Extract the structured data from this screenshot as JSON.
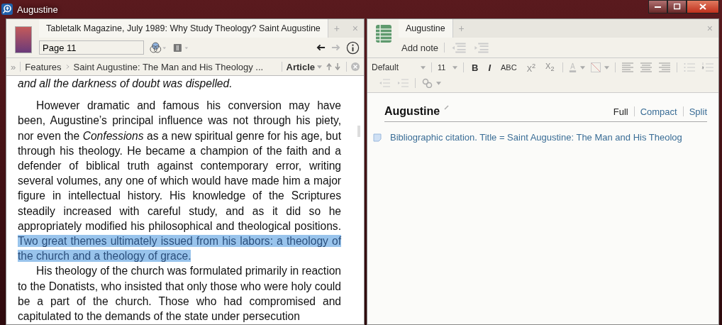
{
  "window": {
    "title": "Augustine"
  },
  "reader": {
    "tabs": [
      {
        "label": "Tabletalk Magazine, July 1989: Why Study Theology? Saint Augustine",
        "selected": true
      }
    ],
    "new_tab": "+",
    "close": "×",
    "page_field": {
      "value": "Page 11"
    },
    "breadcrumb": {
      "expand": "»",
      "items": [
        "Features",
        "Saint Augustine: The Man and His Theology ..."
      ],
      "section": "Article"
    },
    "paragraphs": [
      {
        "kind": "quote",
        "segments": [
          {
            "text": "and all the darkness of doubt was dispelled.",
            "highlighted": false
          }
        ]
      },
      {
        "kind": "body",
        "segments": [
          {
            "text": "However dramatic and famous his conversion may have been, Augustine’s principal influence was not through his piety, nor even the *Confessions* as a new spiritual genre for his age, but through his theology. He became a champion of the faith and a defender of biblical truth against contemporary error, writing several volumes, any one of which would have made him a major figure in intellectual history. His knowledge of the Scriptures steadily increased with careful study, and as it did so he appropriately modified his philosophical and theological positions. ",
            "highlighted": false
          },
          {
            "text": "Two great themes ultimately issued from his labors: a theology of the church and a theology of grace.",
            "highlighted": true
          }
        ]
      },
      {
        "kind": "body",
        "segments": [
          {
            "text": "His theology of the church was formulated primarily in reaction to the Donatists, who insisted that only those who were holy could be a part of the church. Those who had compromised and capitulated to the demands of the state under persecution",
            "highlighted": false
          }
        ]
      }
    ]
  },
  "notes": {
    "tabs": [
      {
        "label": "Augustine",
        "selected": true
      }
    ],
    "new_tab": "+",
    "close": "×",
    "add_note": "Add note",
    "toolbar": {
      "style": "Default",
      "size": "11",
      "bold": "B",
      "italic": "I",
      "caps": "ABC",
      "superscript": "X$^{2}$",
      "subscript": "X$_{2}$"
    },
    "heading": "Augustine",
    "views": [
      {
        "label": "Full",
        "selected": true
      },
      {
        "label": "Compact",
        "selected": false
      },
      {
        "label": "Split",
        "selected": false
      }
    ],
    "items": [
      {
        "text": "Bibliographic citation. Title = Saint Augustine: The Man and His Theolog"
      }
    ]
  }
}
